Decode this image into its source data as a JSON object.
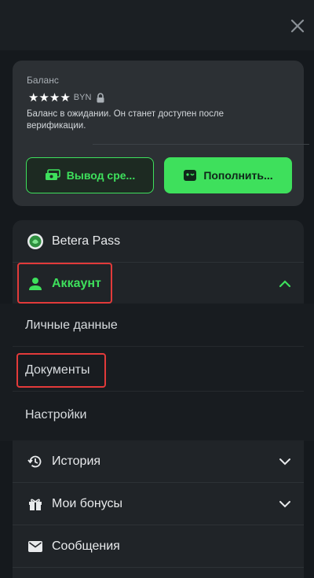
{
  "balance": {
    "label": "Баланс",
    "masked_amount": "★★★★",
    "currency": "BYN",
    "note": "Баланс в ожидании. Он станет доступен после верификации."
  },
  "actions": {
    "withdraw_label": "Вывод сре...",
    "deposit_label": "Пополнить..."
  },
  "menu": {
    "betera_pass": "Betera Pass",
    "account": "Аккаунт",
    "account_items": [
      "Личные данные",
      "Документы",
      "Настройки"
    ],
    "history": "История",
    "bonuses": "Мои бонусы",
    "messages": "Сообщения"
  },
  "colors": {
    "accent": "#3ee05c",
    "highlight": "#e23a3a",
    "background": "#15191d"
  }
}
